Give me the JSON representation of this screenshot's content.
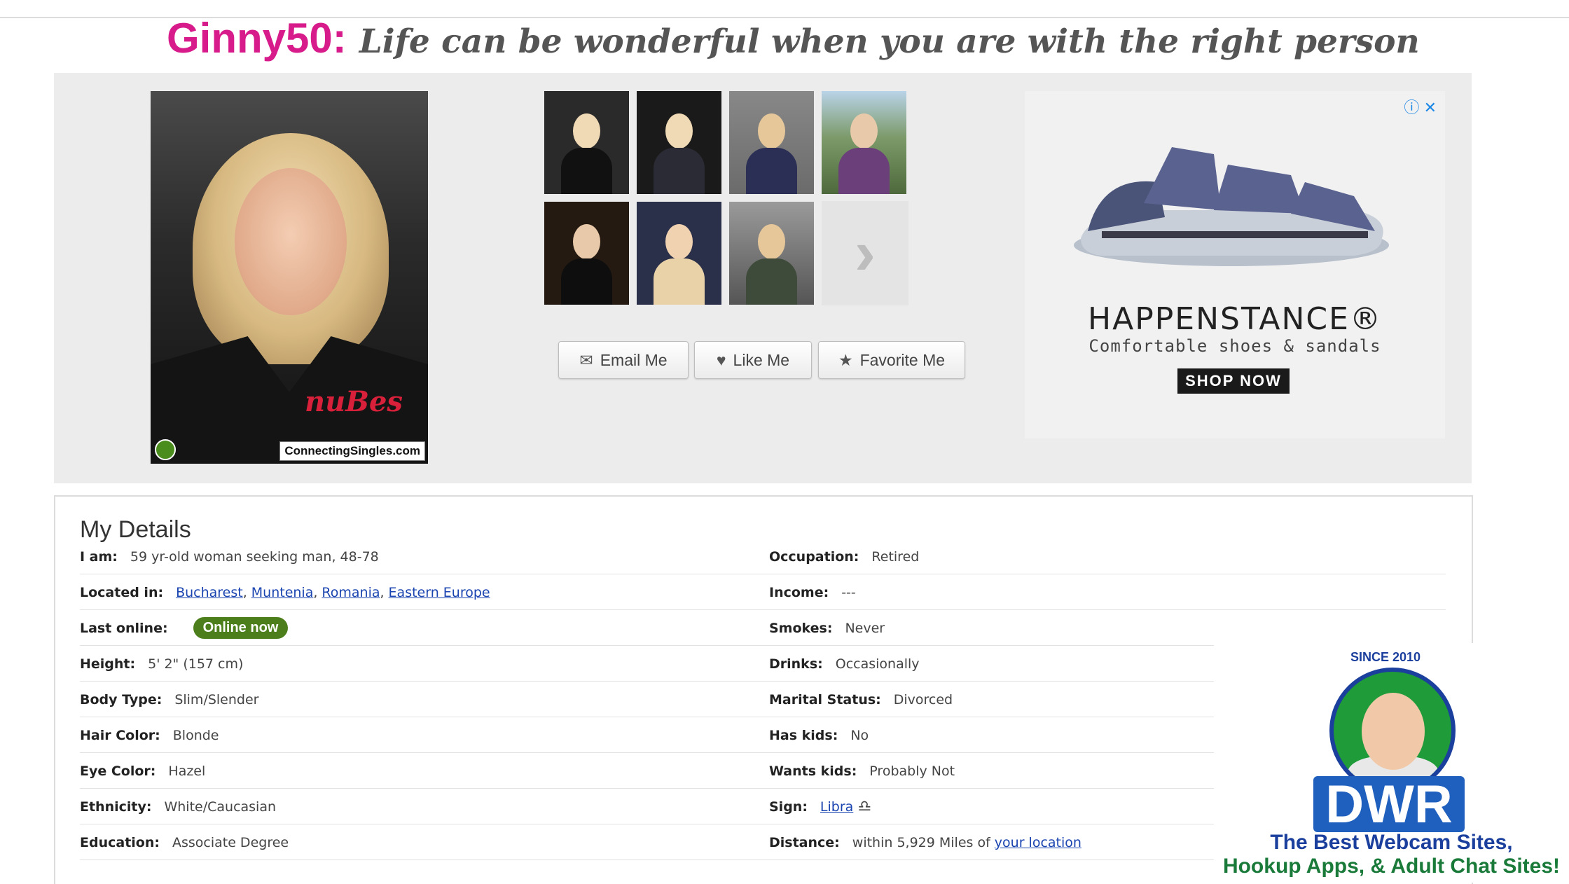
{
  "headline": {
    "username": "Ginny50",
    "colon": ":",
    "tagline": "Life can be wonderful when you are with the right person"
  },
  "main_photo": {
    "brand_text": "nuBes",
    "watermark": "ConnectingSingles.com"
  },
  "actions": {
    "email": "Email Me",
    "like": "Like Me",
    "favorite": "Favorite Me"
  },
  "ad": {
    "brand": "HAPPENSTANCE®",
    "subtitle": "Comfortable shoes & sandals",
    "cta": "SHOP NOW",
    "info_icon": "ⓘ",
    "close_icon": "✕"
  },
  "details": {
    "title": "My Details",
    "left": [
      {
        "label": "I am:",
        "value": "59 yr-old woman seeking man, 48-78"
      },
      {
        "label": "Located in:",
        "links": [
          "Bucharest",
          "Muntenia",
          "Romania",
          "Eastern Europe"
        ]
      },
      {
        "label": "Last online:",
        "badge": "Online now"
      },
      {
        "label": "Height:",
        "value": "5' 2\"  (157 cm)"
      },
      {
        "label": "Body Type:",
        "value": "Slim/Slender"
      },
      {
        "label": "Hair Color:",
        "value": "Blonde"
      },
      {
        "label": "Eye Color:",
        "value": "Hazel"
      },
      {
        "label": "Ethnicity:",
        "value": "White/Caucasian"
      },
      {
        "label": "Education:",
        "value": "Associate Degree"
      }
    ],
    "right": [
      {
        "label": "Occupation:",
        "value": "Retired"
      },
      {
        "label": "Income:",
        "value": "---"
      },
      {
        "label": "Smokes:",
        "value": "Never"
      },
      {
        "label": "Drinks:",
        "value": "Occasionally"
      },
      {
        "label": "Marital Status:",
        "value": "Divorced"
      },
      {
        "label": "Has kids:",
        "value": "No"
      },
      {
        "label": "Wants kids:",
        "value": "Probably Not"
      },
      {
        "label": "Sign:",
        "link": "Libra"
      },
      {
        "label": "Distance:",
        "value": "within 5,929 Miles of",
        "link": "your location"
      }
    ]
  },
  "dwr": {
    "since": "SINCE 2010",
    "logo": "DWR",
    "line1": "The Best Webcam Sites,",
    "line2": "Hookup Apps, & Adult Chat Sites!"
  },
  "colors": {
    "username": "#d81b8a",
    "online": "#4c7f1c",
    "link": "#1a44b0",
    "dwr_blue": "#1b3f9c"
  }
}
